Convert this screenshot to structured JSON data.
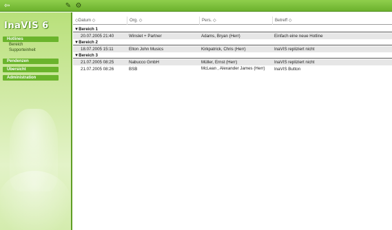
{
  "app": {
    "logo_text": "InaVIS 6"
  },
  "toolbar": {
    "back_icon": "back-arrow-icon",
    "edit_icon": "pencil-icon",
    "settings_icon": "gear-icon"
  },
  "sidebar": {
    "sections": [
      {
        "label": "Hotlines",
        "items": [
          "Bereich",
          "Supporteinheit"
        ]
      },
      {
        "label": "Pendenzen",
        "items": []
      },
      {
        "label": "Übersicht",
        "items": []
      },
      {
        "label": "Administration",
        "items": []
      }
    ]
  },
  "table": {
    "columns": [
      "Datum",
      "Org.",
      "Pers.",
      "Betreff"
    ],
    "groups": [
      {
        "label": "Bereich 1",
        "rows": [
          [
            "20.07.2005 21:40",
            "Winslet + Partner",
            "Adams, Bryan (Herr)",
            "Einfach eine neue Hotline"
          ]
        ]
      },
      {
        "label": "Bereich 2",
        "rows": [
          [
            "18.07.2005 15:11",
            "Elton John Musics",
            "Kirkpatrick, Chris (Herr)",
            "InaVIS repliziert nicht"
          ]
        ]
      },
      {
        "label": "Bereich 3",
        "rows": [
          [
            "21.07.2005 08:25",
            "Nabucco GmbH",
            "Müller, Ernst (Herr)",
            "InaVIS repliziert nicht"
          ],
          [
            "21.07.2005 08:26",
            "BSB",
            "McLean , Alexander James (Herr)",
            "InaVIS Button"
          ]
        ]
      }
    ]
  }
}
